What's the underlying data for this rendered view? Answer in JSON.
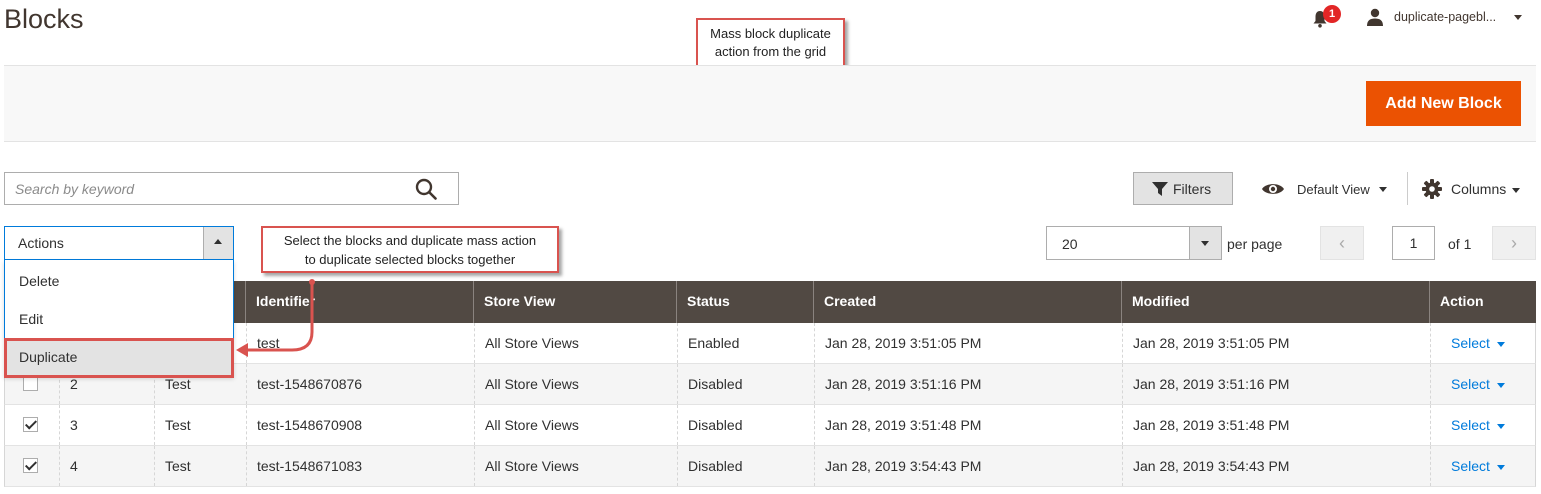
{
  "header": {
    "title": "Blocks",
    "notification_count": "1",
    "user_name": "duplicate-pagebl..."
  },
  "page_actions": {
    "add_new_label": "Add New Block"
  },
  "search": {
    "placeholder": "Search by keyword"
  },
  "toolbar": {
    "filters_label": "Filters",
    "view_label": "Default View",
    "columns_label": "Columns"
  },
  "mass_actions": {
    "label": "Actions",
    "options": [
      "Delete",
      "Edit",
      "Duplicate"
    ]
  },
  "pagination": {
    "per_page_value": "20",
    "per_page_label": "per page",
    "current_page": "1",
    "of_label": "of 1"
  },
  "grid": {
    "columns": [
      "",
      "",
      "",
      "Identifier",
      "Store View",
      "Status",
      "Created",
      "Modified",
      "Action"
    ],
    "rows": [
      {
        "checked": false,
        "id": "",
        "title": "",
        "identifier": "test",
        "store_view": "All Store Views",
        "status": "Enabled",
        "created": "Jan 28, 2019 3:51:05 PM",
        "modified": "Jan 28, 2019 3:51:05 PM",
        "action": "Select"
      },
      {
        "checked": false,
        "id": "2",
        "title": "Test",
        "identifier": "test-1548670876",
        "store_view": "All Store Views",
        "status": "Disabled",
        "created": "Jan 28, 2019 3:51:16 PM",
        "modified": "Jan 28, 2019 3:51:16 PM",
        "action": "Select"
      },
      {
        "checked": true,
        "id": "3",
        "title": "Test",
        "identifier": "test-1548670908",
        "store_view": "All Store Views",
        "status": "Disabled",
        "created": "Jan 28, 2019 3:51:48 PM",
        "modified": "Jan 28, 2019 3:51:48 PM",
        "action": "Select"
      },
      {
        "checked": true,
        "id": "4",
        "title": "Test",
        "identifier": "test-1548671083",
        "store_view": "All Store Views",
        "status": "Disabled",
        "created": "Jan 28, 2019 3:54:43 PM",
        "modified": "Jan 28, 2019 3:54:43 PM",
        "action": "Select"
      }
    ]
  },
  "annotations": {
    "top_note_line1": "Mass block duplicate",
    "top_note_line2": "action from the grid",
    "side_note_line1": "Select the blocks and duplicate mass action",
    "side_note_line2": "to duplicate selected blocks together"
  },
  "colors": {
    "accent": "#eb5202",
    "grid_header": "#514943",
    "link": "#007bdb",
    "callout_border": "#d9534f"
  }
}
